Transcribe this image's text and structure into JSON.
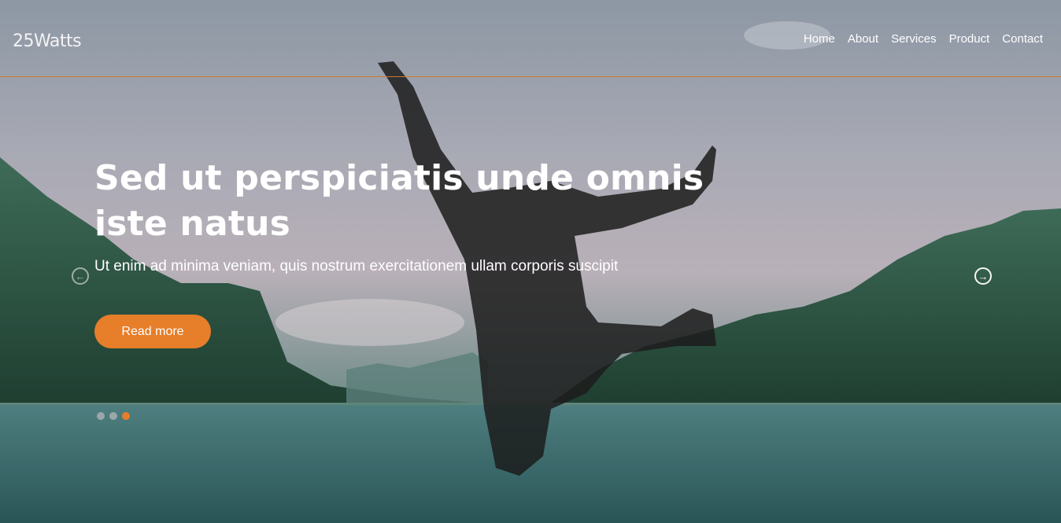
{
  "brand": {
    "logo_text": "25Watts"
  },
  "nav": {
    "items": [
      {
        "label": "Home"
      },
      {
        "label": "About"
      },
      {
        "label": "Services"
      },
      {
        "label": "Product"
      },
      {
        "label": "Contact"
      }
    ]
  },
  "hero": {
    "title_line1": "Sed ut perspiciatis unde omnis",
    "title_line2": "iste natus",
    "subtitle": "Ut enim ad minima veniam, quis nostrum exercitationem ullam corporis suscipit",
    "cta_label": "Read more",
    "background_image": "man-jumping-over-lake-photo"
  },
  "slider": {
    "prev_icon": "arrow-left-circle-icon",
    "next_icon": "arrow-right-circle-icon",
    "slide_count": 3,
    "active_slide": 3
  },
  "colors": {
    "accent": "#e67e2a",
    "nav_divider": "#d0792e",
    "text": "#ffffff"
  }
}
